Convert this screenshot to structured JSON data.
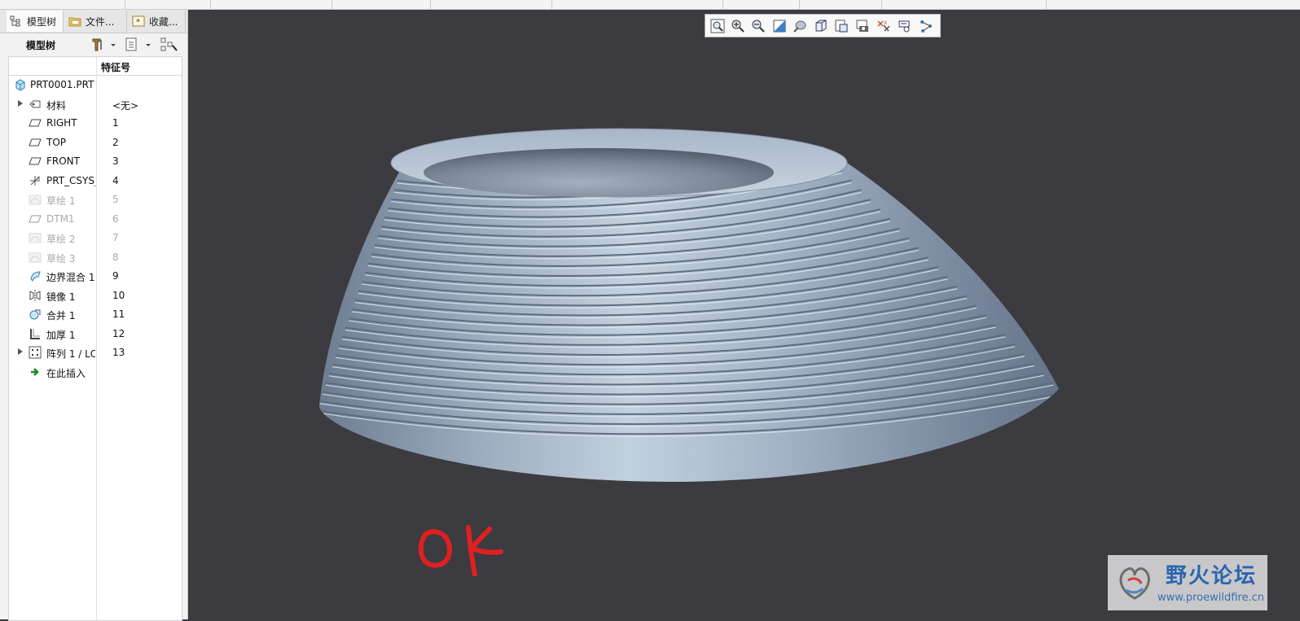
{
  "panel": {
    "tabs": [
      {
        "label": "模型树"
      },
      {
        "label": "文件..."
      },
      {
        "label": "收藏..."
      }
    ],
    "toolbar_label": "模型树",
    "column_header": "特征号"
  },
  "tree_rows": [
    {
      "name": "PRT0001.PRT",
      "id": "",
      "icon": "part-icon",
      "expand": false,
      "dim": false,
      "root": true
    },
    {
      "name": "材料",
      "id": "<无>",
      "icon": "material-icon",
      "expand": true,
      "dim": false
    },
    {
      "name": "RIGHT",
      "id": "1",
      "icon": "datum-plane-icon",
      "expand": false,
      "dim": false
    },
    {
      "name": "TOP",
      "id": "2",
      "icon": "datum-plane-icon",
      "expand": false,
      "dim": false
    },
    {
      "name": "FRONT",
      "id": "3",
      "icon": "datum-plane-icon",
      "expand": false,
      "dim": false
    },
    {
      "name": "PRT_CSYS_",
      "id": "4",
      "icon": "csys-icon",
      "expand": false,
      "dim": false
    },
    {
      "name": "草绘 1",
      "id": "5",
      "icon": "sketch-icon",
      "expand": false,
      "dim": true
    },
    {
      "name": "DTM1",
      "id": "6",
      "icon": "datum-plane-icon",
      "expand": false,
      "dim": true
    },
    {
      "name": "草绘 2",
      "id": "7",
      "icon": "sketch-icon",
      "expand": false,
      "dim": true
    },
    {
      "name": "草绘 3",
      "id": "8",
      "icon": "sketch-icon",
      "expand": false,
      "dim": true
    },
    {
      "name": "边界混合 1",
      "id": "9",
      "icon": "boundary-blend-icon",
      "expand": false,
      "dim": false
    },
    {
      "name": "镜像 1",
      "id": "10",
      "icon": "mirror-icon",
      "expand": false,
      "dim": false
    },
    {
      "name": "合并 1",
      "id": "11",
      "icon": "merge-icon",
      "expand": false,
      "dim": false
    },
    {
      "name": "加厚 1",
      "id": "12",
      "icon": "thicken-icon",
      "expand": false,
      "dim": false
    },
    {
      "name": "阵列 1 / LC",
      "id": "13",
      "icon": "pattern-icon",
      "expand": true,
      "dim": false
    },
    {
      "name": "在此插入",
      "id": "",
      "icon": "insert-here-icon",
      "expand": false,
      "dim": false
    }
  ],
  "view_toolbar": [
    "refit-icon",
    "zoom-in-icon",
    "zoom-out-icon",
    "repaint-icon",
    "display-style-icon",
    "saved-views-icon",
    "view-manager-icon",
    "perspective-icon",
    "datum-display-icon",
    "annotation-display-icon",
    "spin-center-icon"
  ],
  "annotation": "OK",
  "watermark": {
    "title": "野火论坛",
    "url": "www.proewildfire.cn"
  },
  "colors": {
    "background": "#3b3b40",
    "model": "#a6b4c6",
    "annotation": "#e02020"
  }
}
